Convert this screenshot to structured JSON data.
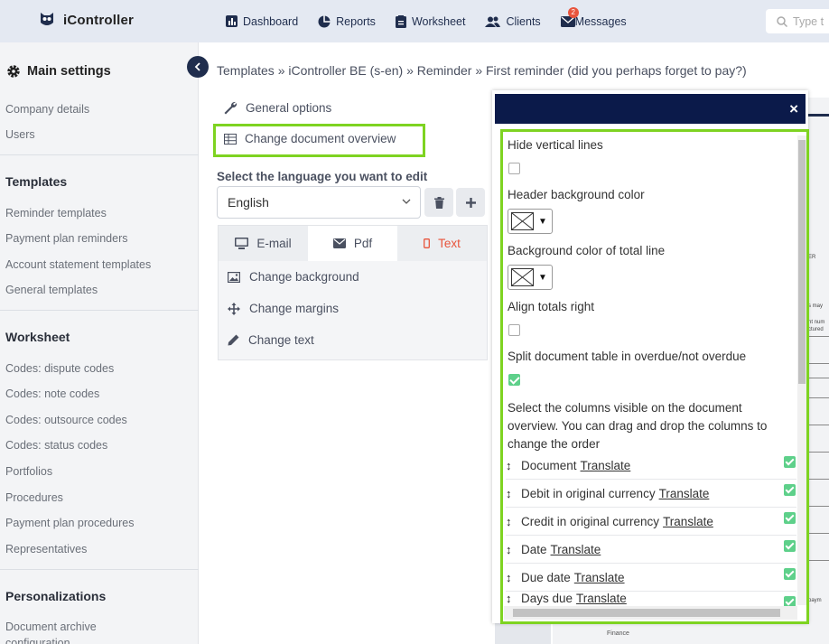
{
  "app": {
    "name": "iController"
  },
  "nav": [
    {
      "label": "Dashboard",
      "icon": "bar-chart-icon"
    },
    {
      "label": "Reports",
      "icon": "pie-chart-icon"
    },
    {
      "label": "Worksheet",
      "icon": "clipboard-icon"
    },
    {
      "label": "Clients",
      "icon": "users-icon"
    },
    {
      "label": "Messages",
      "icon": "envelope-icon",
      "badge": "2"
    }
  ],
  "search": {
    "placeholder": "Type t"
  },
  "sidebar": {
    "main_title": "Main settings",
    "items_top": [
      "Company details",
      "Users"
    ],
    "sections": [
      {
        "title": "Templates",
        "items": [
          "Reminder templates",
          "Payment plan reminders",
          "Account statement templates",
          "General templates"
        ]
      },
      {
        "title": "Worksheet",
        "items": [
          "Codes: dispute codes",
          "Codes: note codes",
          "Codes: outsource codes",
          "Codes: status codes",
          "Portfolios",
          "Procedures",
          "Payment plan procedures",
          "Representatives"
        ]
      },
      {
        "title": "Personalizations",
        "items": [
          "Document archive",
          "configuration"
        ]
      }
    ]
  },
  "breadcrumb": "Templates » iController BE (s-en) » Reminder » First reminder (did you perhaps forget to pay?)",
  "options": {
    "general": "General options",
    "change_overview": "Change document overview"
  },
  "language": {
    "label": "Select the language you want to edit",
    "value": "English"
  },
  "tabs": [
    {
      "label": "E-mail"
    },
    {
      "label": "Pdf"
    },
    {
      "label": "Text"
    }
  ],
  "panel_options": [
    "Change background",
    "Change margins",
    "Change text"
  ],
  "modal": {
    "close": "×",
    "hide_vertical_lines": {
      "label": "Hide vertical lines",
      "checked": false
    },
    "header_bg": {
      "label": "Header background color"
    },
    "total_bg": {
      "label": "Background color of total line"
    },
    "align_totals": {
      "label": "Align totals right",
      "checked": false
    },
    "split_table": {
      "label": "Split document table in overdue/not overdue",
      "checked": true
    },
    "columns_desc": "Select the columns visible on the document overview. You can drag and drop the columns to change the order",
    "translate_label": "Translate",
    "columns": [
      {
        "name": "Document",
        "checked": true
      },
      {
        "name": "Debit in original currency",
        "checked": true
      },
      {
        "name": "Credit in original currency",
        "checked": true
      },
      {
        "name": "Date",
        "checked": true
      },
      {
        "name": "Due date",
        "checked": true
      },
      {
        "name": "Days due",
        "checked": true
      }
    ]
  },
  "doc_preview": {
    "snippets": [
      "ER",
      "s may",
      "nt num",
      "ctured",
      "paym"
    ],
    "footer": "Finance"
  },
  "colors": {
    "accent_green": "#7ed321",
    "navy": "#0b1a4a",
    "check_green": "#5ed08a",
    "text_tab_red": "#e8543c"
  }
}
